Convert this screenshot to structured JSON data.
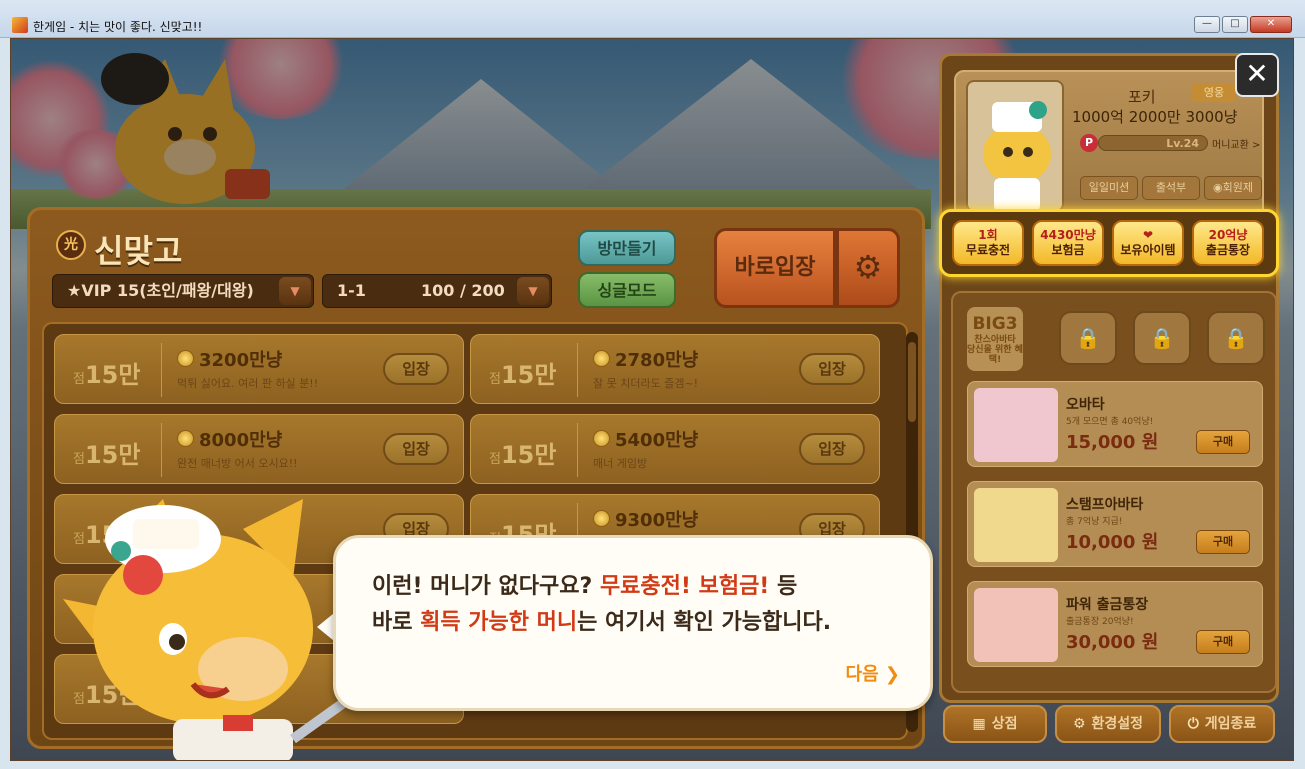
{
  "window": {
    "title": "한게임 - 치는 맛이 좋다. 신맞고!!",
    "min": "—",
    "max": "□",
    "close": "✕"
  },
  "game": {
    "title": "신맞고",
    "gwang_icon": "光",
    "vip_filter": "★VIP 15(초인/패왕/대왕)",
    "rule_a": "1-1",
    "rule_b": "100 / 200",
    "dropdown_arrow": "▼",
    "make_room": "방만들기",
    "single_mode": "싱글모드",
    "quick_enter": "바로입장",
    "settings_icon": "⚙"
  },
  "rooms": [
    {
      "point_prefix": "점",
      "point": "15만",
      "money": "3200만냥",
      "desc": "먹튀 싫어요. 여러 판 하실 분!!",
      "enter": "입장"
    },
    {
      "point_prefix": "점",
      "point": "15만",
      "money": "2780만냥",
      "desc": "잘 못 치더라도 즐겜~!",
      "enter": "입장"
    },
    {
      "point_prefix": "점",
      "point": "15만",
      "money": "8000만냥",
      "desc": "완전 매너방 어서 오시요!!",
      "enter": "입장"
    },
    {
      "point_prefix": "점",
      "point": "15만",
      "money": "5400만냥",
      "desc": "매너 게임방",
      "enter": "입장"
    },
    {
      "point_prefix": "점",
      "point": "15만",
      "money": "9300만냥",
      "desc": "",
      "enter": "입장"
    }
  ],
  "profile": {
    "nickname": "포키",
    "grade": "영웅",
    "money": "1000억 2000만 3000냥",
    "p_icon": "P",
    "level": "Lv.24",
    "exchange": "머니교환 >",
    "daily_mission": "일일미션",
    "attendance": "출석부",
    "membership": "◉회원제"
  },
  "close_button": "✕",
  "benefits": [
    {
      "top": "1회",
      "bottom": "무료충전"
    },
    {
      "top": "4430만냥",
      "bottom": "보험금"
    },
    {
      "top": "❤",
      "bottom": "보유아이템"
    },
    {
      "top": "20억냥",
      "bottom": "출금통장"
    }
  ],
  "big3": {
    "title": "BIG3",
    "sub": "찬스아바타",
    "note": "당신을 위한 혜택!",
    "lock_icon": "🔒"
  },
  "shop_items": [
    {
      "name": "오바타",
      "desc": "5개 모으면 총 40억냥!",
      "price": "15,000 원",
      "buy": "구매"
    },
    {
      "name": "스탬프아바타",
      "desc": "총 7억냥 지급!",
      "price": "10,000 원",
      "buy": "구매"
    },
    {
      "name": "파워 출금통장",
      "desc": "출금통장 20억냥!",
      "price": "30,000 원",
      "buy": "구매"
    }
  ],
  "bottom_buttons": {
    "shop": "상점",
    "settings": "환경설정",
    "exit": "게임종료",
    "shop_icon": "▦",
    "settings_icon": "⚙",
    "exit_icon": "⏻"
  },
  "tutorial": {
    "line1_a": "이런! 머니가 없다구요? ",
    "line1_b": "무료충전! 보험금!",
    "line1_c": " 등",
    "line2_a": "바로 ",
    "line2_b": "획득 가능한 머니",
    "line2_c": "는 여기서 확인 가능합니다.",
    "next": "다음 ❯"
  },
  "colors": {
    "highlight": "#ffd531",
    "accent_red": "#d23a16",
    "next_orange": "#f08c12"
  }
}
